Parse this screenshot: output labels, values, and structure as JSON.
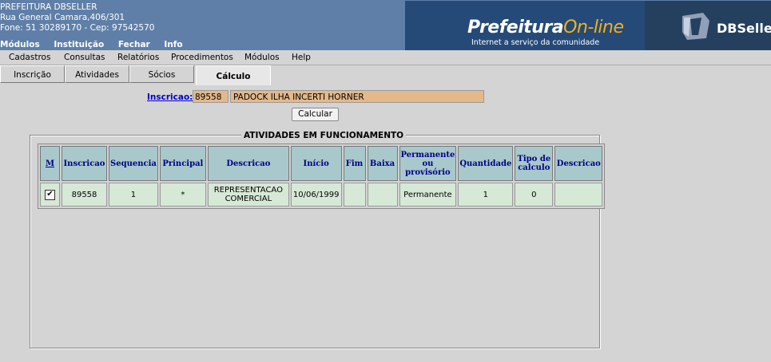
{
  "header": {
    "org_name": "PREFEITURA DBSELLER",
    "address": "Rua General Camara,406/301",
    "contact": "Fone: 51 30289170  -  Cep: 97542570",
    "top_menu": [
      "Módulos",
      "Instituição",
      "Fechar",
      "Info"
    ],
    "logo_main": "Prefeitura",
    "logo_online": "On-line",
    "logo_tagline": "Internet a serviço da comunidade",
    "company_logo": "DBSeller"
  },
  "menubar": [
    "Cadastros",
    "Consultas",
    "Relatórios",
    "Procedimentos",
    "Módulos",
    "Help"
  ],
  "tabs": [
    "Inscrição",
    "Atividades",
    "Sócios",
    "Cálculo"
  ],
  "active_tab": "Cálculo",
  "form": {
    "inscricao_label": "Inscricao:",
    "inscricao_code": "89558",
    "inscricao_name": "PADOCK ILHA INCERTI HORNER",
    "calcular_label": "Calcular"
  },
  "section_title": "ATIVIDADES EM FUNCIONAMENTO",
  "table": {
    "columns": [
      "M",
      "Inscricao",
      "Sequencia",
      "Principal",
      "Descricao",
      "Início",
      "Fim",
      "Baixa",
      "Permanente ou provisório",
      "Quantidade",
      "Tipo de calculo",
      "Descricao"
    ],
    "rows": [
      {
        "checked": "✔",
        "inscricao": "89558",
        "sequencia": "1",
        "principal": "*",
        "descricao": "REPRESENTACAO COMERCIAL",
        "inicio": "10/06/1999",
        "fim": "",
        "baixa": "",
        "permanente": "Permanente",
        "quantidade": "1",
        "tipo_calculo": "0",
        "descricao2": ""
      }
    ]
  },
  "colors": {
    "header_bg": "#5f7fa8",
    "banner_bg": "#254a78",
    "dbseller_bg": "#25405e",
    "logo_accent": "#f2b21c",
    "input_bg": "#e4b98a",
    "table_header_bg": "#a8c8cc",
    "table_cell_bg": "#d6e8d6",
    "link": "#0000cc"
  }
}
